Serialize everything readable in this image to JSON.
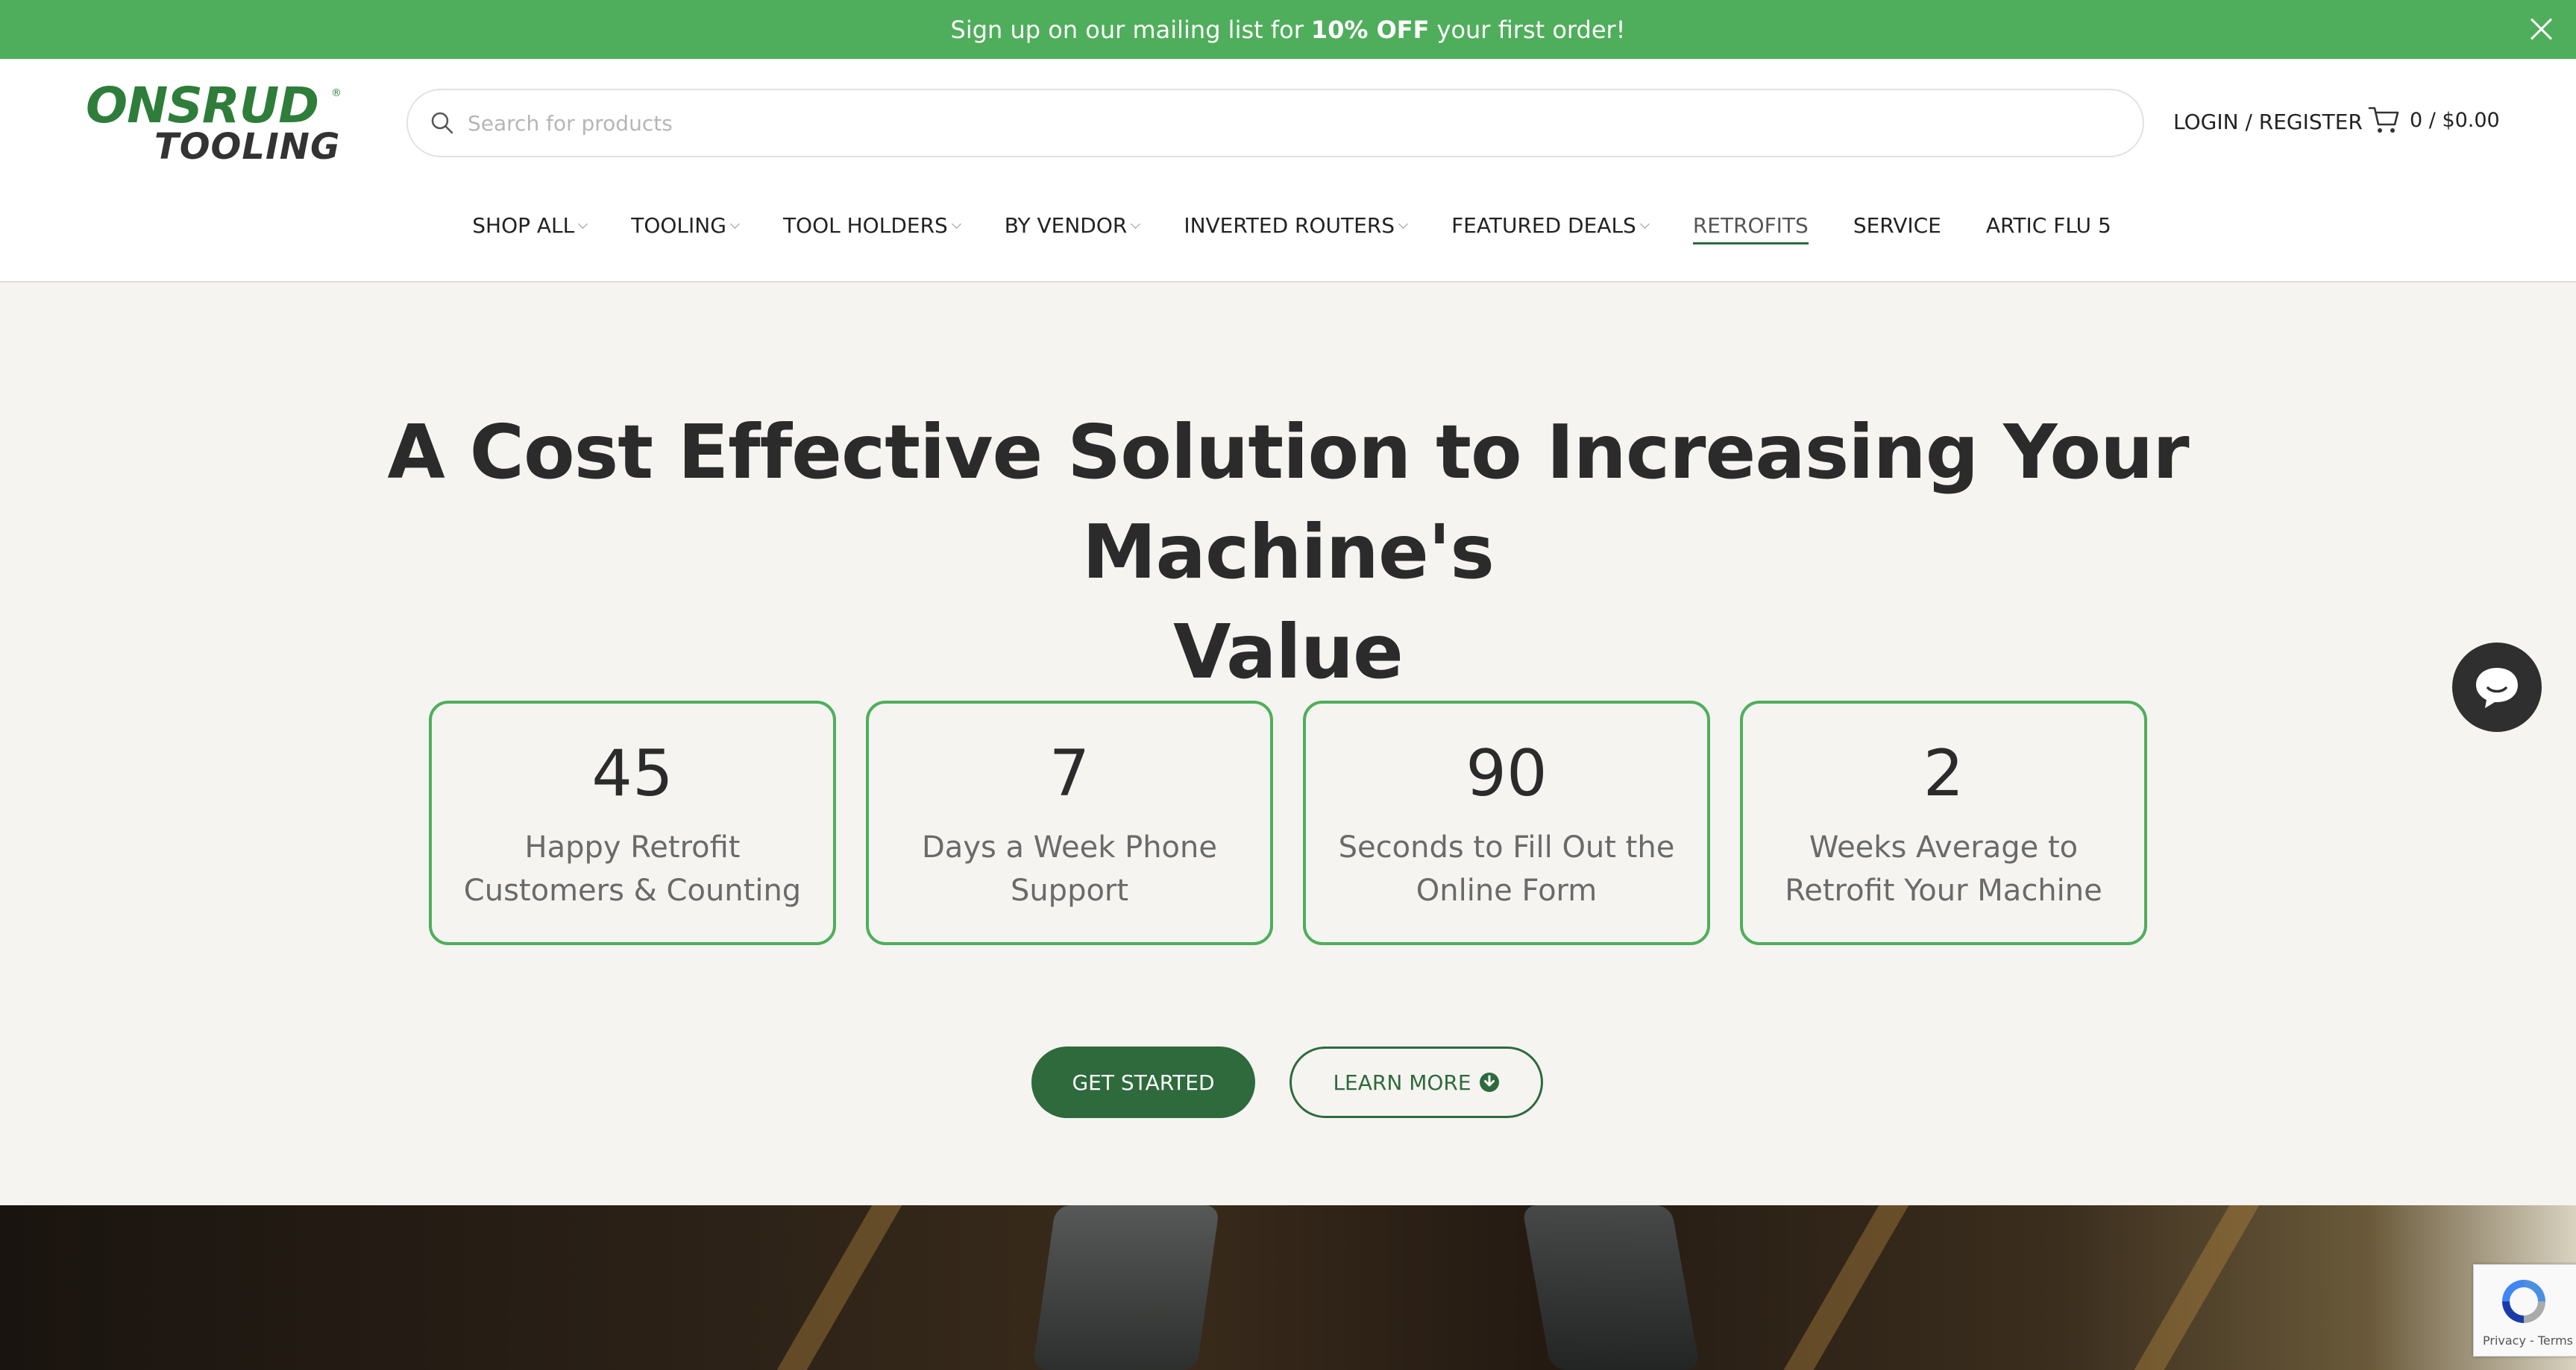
{
  "promo": {
    "text_before": "Sign up on our mailing list for",
    "text_bold": "10% OFF",
    "text_after": "your first order!"
  },
  "header": {
    "logo_top": "ONSRUD",
    "logo_bottom": "TOOLING",
    "search_placeholder": "Search for products",
    "login_label": "LOGIN / REGISTER",
    "cart_label": "0 / $0.00"
  },
  "nav": {
    "items": [
      {
        "label": "SHOP ALL",
        "has_dropdown": true
      },
      {
        "label": "TOOLING",
        "has_dropdown": true
      },
      {
        "label": "TOOL HOLDERS",
        "has_dropdown": true
      },
      {
        "label": "BY VENDOR",
        "has_dropdown": true
      },
      {
        "label": "INVERTED ROUTERS",
        "has_dropdown": true
      },
      {
        "label": "FEATURED DEALS",
        "has_dropdown": true
      },
      {
        "label": "RETROFITS",
        "has_dropdown": false,
        "active": true
      },
      {
        "label": "SERVICE",
        "has_dropdown": false
      },
      {
        "label": "ARTIC FLU 5",
        "has_dropdown": false
      }
    ]
  },
  "hero": {
    "title_line1": "A Cost Effective Solution to Increasing Your Machine's",
    "title_line2": "Value"
  },
  "stats": [
    {
      "number": "45",
      "label": "Happy Retrofit Customers & Counting"
    },
    {
      "number": "7",
      "label": "Days a Week Phone Support"
    },
    {
      "number": "90",
      "label": "Seconds to Fill Out the Online Form"
    },
    {
      "number": "2",
      "label": "Weeks Average to Retrofit Your Machine"
    }
  ],
  "buttons": {
    "primary": "GET STARTED",
    "secondary": "LEARN MORE"
  },
  "recaptcha": {
    "text": "Privacy - Terms"
  },
  "colors": {
    "promo_bg": "#4fae5b",
    "brand_green": "#2e6a3c",
    "stat_border": "#4fae5b",
    "page_bg": "#f5f4f1"
  }
}
